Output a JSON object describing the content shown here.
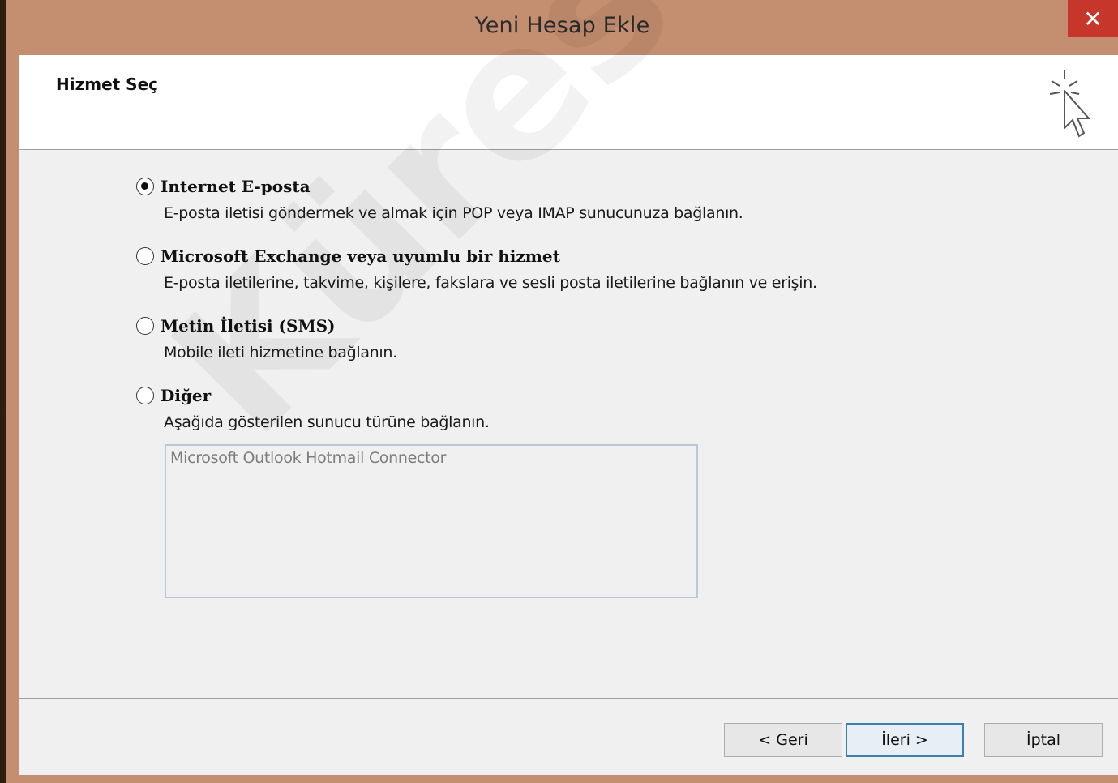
{
  "window": {
    "title": "Yeni Hesap Ekle",
    "close_symbol": "✕"
  },
  "header": {
    "title": "Hizmet Seç",
    "icon": "cursor-sparkle-icon"
  },
  "options": [
    {
      "label": "Internet E-posta",
      "description": "E-posta iletisi göndermek ve almak için POP veya IMAP sunucunuza bağlanın.",
      "selected": true
    },
    {
      "label": "Microsoft Exchange veya uyumlu bir hizmet",
      "description": "E-posta iletilerine, takvime, kişilere, fakslara ve sesli posta iletilerine bağlanın ve erişin.",
      "selected": false
    },
    {
      "label": "Metin İletisi (SMS)",
      "description": "Mobile ileti hizmetine bağlanın.",
      "selected": false
    },
    {
      "label": "Diğer",
      "description": "Aşağıda gösterilen sunucu türüne bağlanın.",
      "selected": false
    }
  ],
  "server_list": {
    "items": [
      "Microsoft Outlook Hotmail Connector"
    ]
  },
  "buttons": {
    "back": "< Geri",
    "next": "İleri >",
    "cancel": "İptal"
  },
  "watermark": "KüreselNet",
  "colors": {
    "titlebar": "#c48e70",
    "close": "#c7362a",
    "default_button_border": "#3c7fb1"
  }
}
